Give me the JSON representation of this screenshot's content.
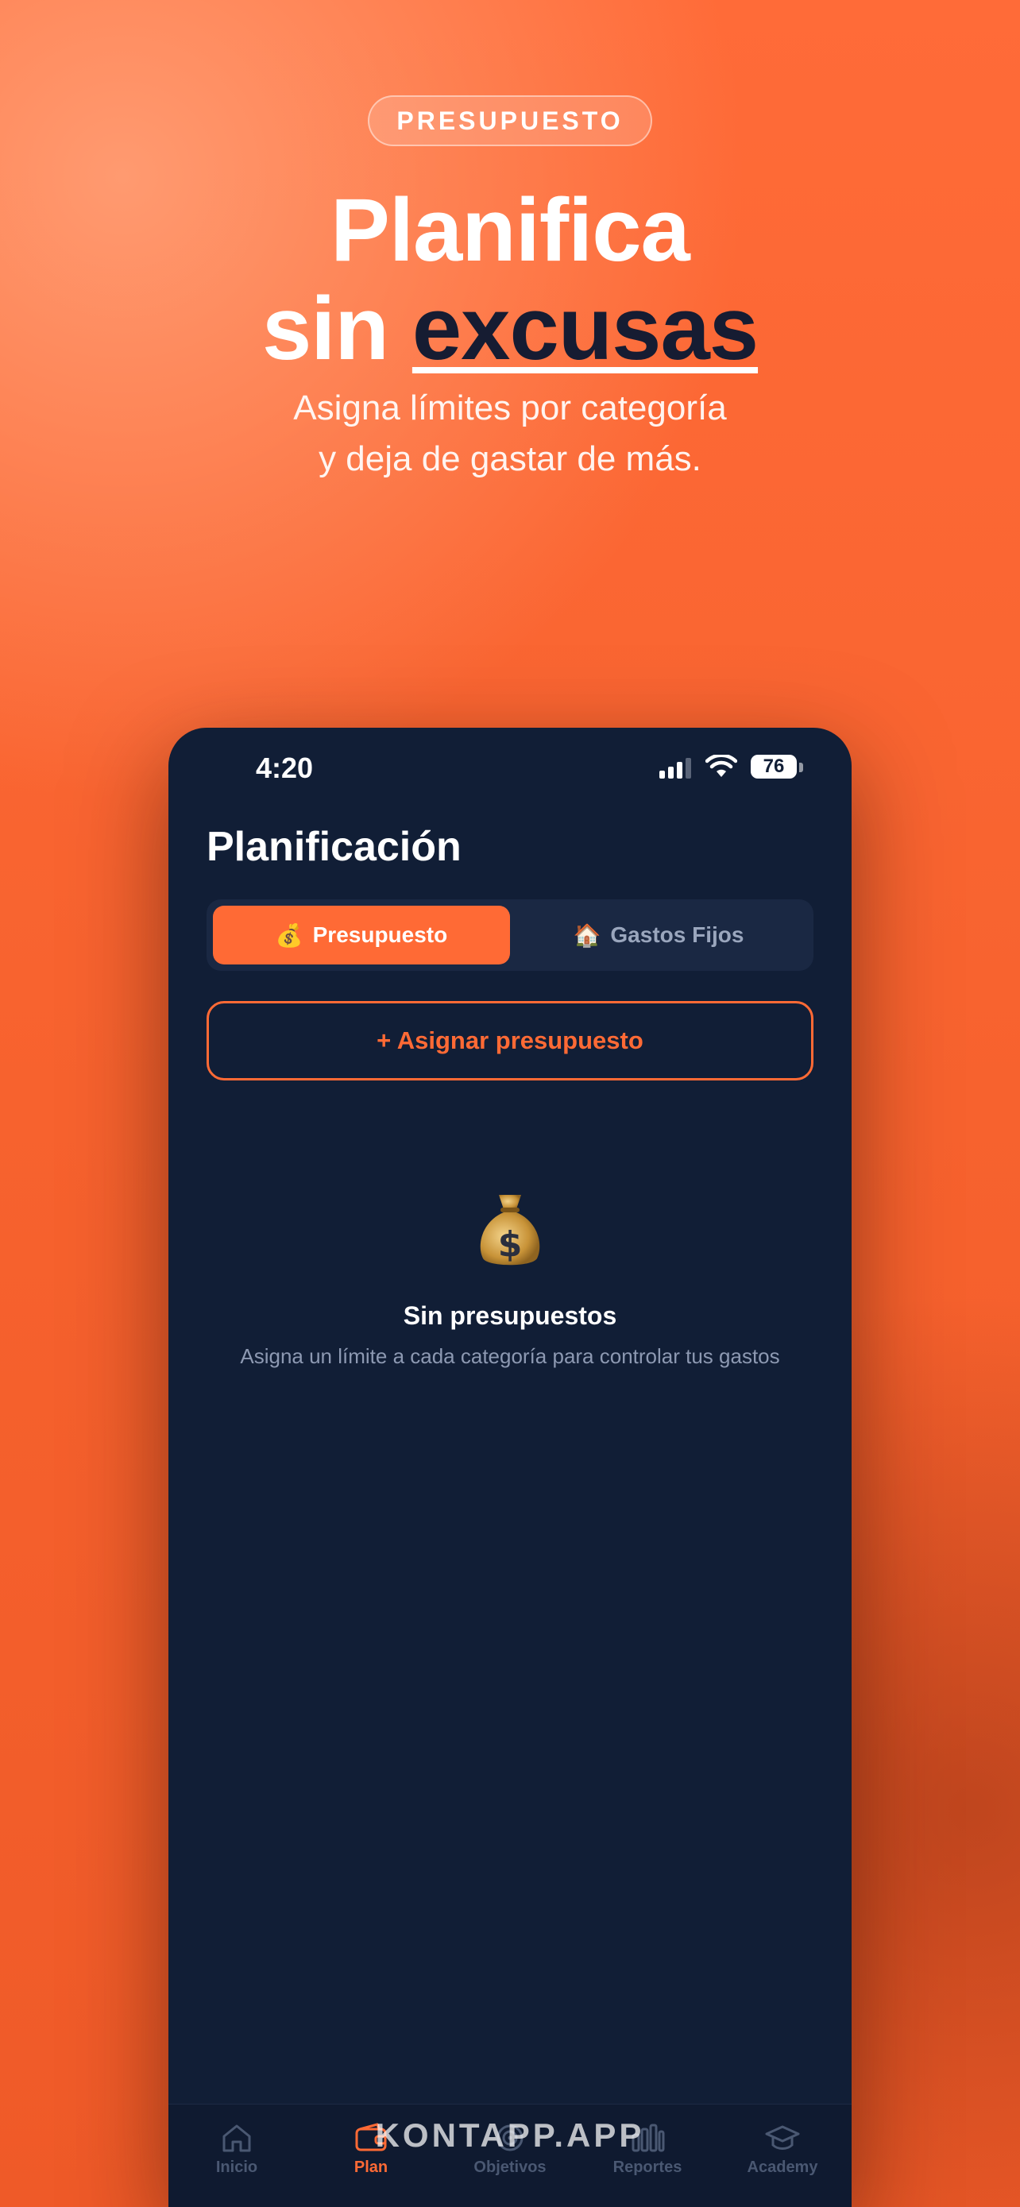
{
  "badge": "PRESUPUESTO",
  "headline": {
    "line1": "Planifica",
    "line2_prefix": "sin ",
    "line2_accent": "excusas"
  },
  "subtitle": {
    "line1": "Asigna límites por categoría",
    "line2": "y deja de gastar de más."
  },
  "status_bar": {
    "time": "4:20",
    "battery": "76"
  },
  "screen": {
    "title": "Planificación",
    "segments": [
      {
        "emoji": "💰",
        "label": "Presupuesto",
        "active": true
      },
      {
        "emoji": "🏠",
        "label": "Gastos Fijos",
        "active": false
      }
    ],
    "assign_button": "+ Asignar presupuesto",
    "empty_state": {
      "icon": "money-bag-icon",
      "title": "Sin presupuestos",
      "description": "Asigna un límite a cada categoría para controlar tus gastos"
    }
  },
  "tabbar": [
    {
      "label": "Inicio",
      "icon": "home-icon",
      "active": false
    },
    {
      "label": "Plan",
      "icon": "wallet-icon",
      "active": true
    },
    {
      "label": "Objetivos",
      "icon": "target-icon",
      "active": false
    },
    {
      "label": "Reportes",
      "icon": "bar-chart-icon",
      "active": false
    },
    {
      "label": "Academy",
      "icon": "graduation-cap-icon",
      "active": false
    }
  ],
  "watermark": "KONTAPP.APP",
  "colors": {
    "accent": "#ff6a35",
    "phone_bg": "#111e36",
    "headline_accent": "#161c32"
  }
}
